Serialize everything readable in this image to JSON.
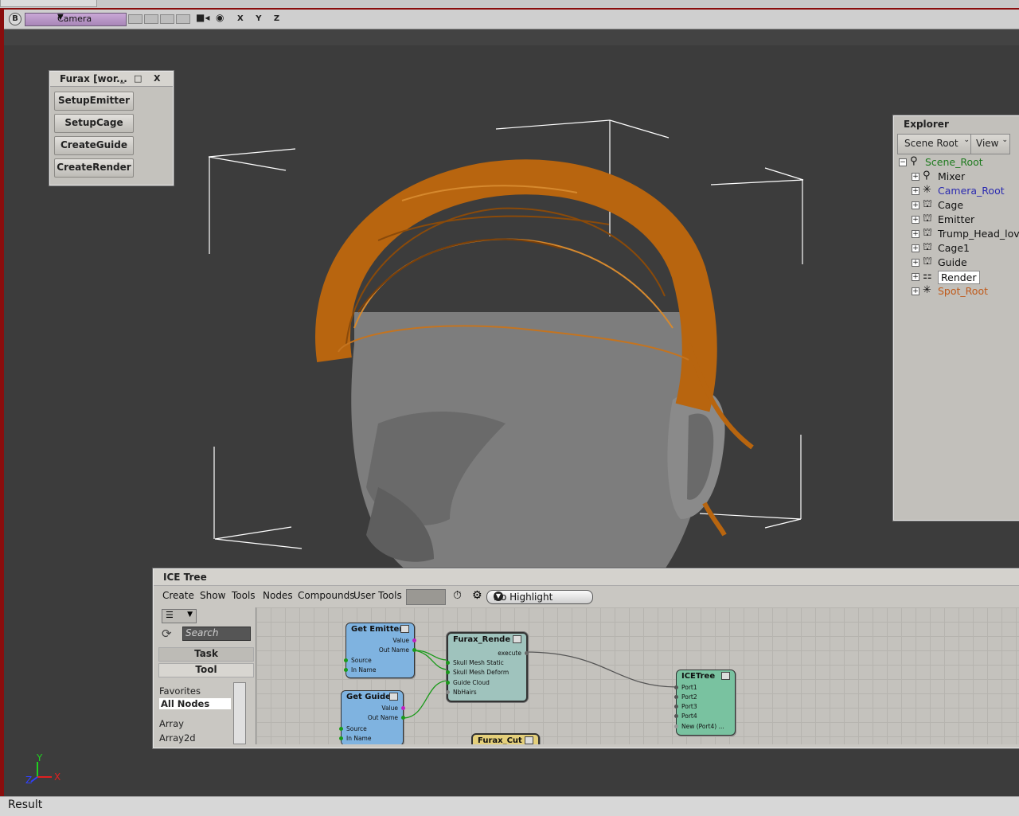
{
  "viewport": {
    "badge": "B",
    "camera": "Camera",
    "axes": "X Y Z",
    "axis_gizmo": {
      "y": "Y",
      "x": "X",
      "z": "Z"
    }
  },
  "palette": {
    "title": "Furax [wor...",
    "buttons": {
      "min": "_",
      "max": "□",
      "close": "X"
    },
    "actions": [
      "SetupEmitter",
      "SetupCage",
      "CreateGuide",
      "CreateRender"
    ]
  },
  "explorer": {
    "title": "Explorer",
    "scope": "Scene Root",
    "view": "View",
    "root": "Scene_Root",
    "items": [
      {
        "label": "Mixer",
        "color": "#111111"
      },
      {
        "label": "Camera_Root",
        "color": "#2a2ab0"
      },
      {
        "label": "Cage",
        "color": "#111111"
      },
      {
        "label": "Emitter",
        "color": "#111111"
      },
      {
        "label": "Trump_Head_lov",
        "color": "#111111"
      },
      {
        "label": "Cage1",
        "color": "#111111"
      },
      {
        "label": "Guide",
        "color": "#111111"
      },
      {
        "label": "Render",
        "color": "#111111",
        "selected": true
      },
      {
        "label": "Spot_Root",
        "color": "#c05a1a"
      }
    ]
  },
  "ice": {
    "title": "ICE Tree",
    "menu": [
      "Create",
      "Show",
      "Tools",
      "Nodes",
      "Compounds",
      "User Tools"
    ],
    "highlight": "No Highlight",
    "search_placeholder": "Search",
    "tabs": {
      "task": "Task",
      "tool": "Tool"
    },
    "list": [
      "Favorites",
      "All Nodes",
      "Array",
      "Array2d"
    ],
    "nodes": {
      "get_emitter": {
        "title": "Get Emitter",
        "ports": [
          "Value",
          "Out Name",
          "Source",
          "In Name"
        ]
      },
      "get_guide": {
        "title": "Get Guide",
        "ports": [
          "Value",
          "Out Name",
          "Source",
          "In Name"
        ]
      },
      "furax_render": {
        "title": "Furax_Rende",
        "ports": [
          "execute",
          "Skull Mesh Static",
          "Skull Mesh Deform",
          "Guide Cloud",
          "NbHairs"
        ]
      },
      "icetree": {
        "title": "ICETree",
        "ports": [
          "Port1",
          "Port2",
          "Port3",
          "Port4",
          "New (Port4) ..."
        ]
      },
      "furax_cut": {
        "title": "Furax_Cut"
      }
    }
  },
  "status": "Result",
  "colors": {
    "hair": "#b8650f",
    "node_blue": "#7fb3e0",
    "node_teal": "#9fc3bd",
    "node_green": "#79c2a0",
    "node_yellow": "#e4cf7a",
    "accent_purple": "#b995c8"
  }
}
